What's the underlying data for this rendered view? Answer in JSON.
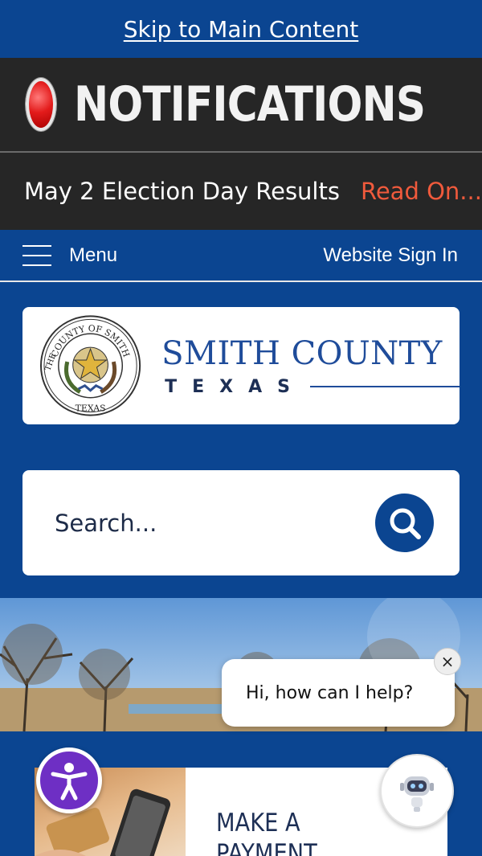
{
  "skip_link": "Skip to Main Content",
  "notifications": {
    "title": "NOTIFICATIONS"
  },
  "alert": {
    "text": "May 2 Election Day Results",
    "link": "Read On..."
  },
  "nav": {
    "menu_label": "Menu",
    "sign_in": "Website Sign In"
  },
  "logo": {
    "name": "SMITH COUNTY",
    "state": "TEXAS",
    "seal_text_top": "COUNTY OF SMITH",
    "seal_text_left": "THE",
    "seal_text_bottom": "TEXAS"
  },
  "search": {
    "placeholder": "Search..."
  },
  "chat": {
    "greeting": "Hi, how can I help?",
    "close": "×"
  },
  "feature": {
    "title_line1": "MAKE A",
    "title_line2": "PAYMENT"
  },
  "colors": {
    "brand_blue": "#0b4591",
    "alert_orange": "#f05a3c",
    "dark_bar": "#262626",
    "a11y_purple": "#6e2fc4"
  }
}
